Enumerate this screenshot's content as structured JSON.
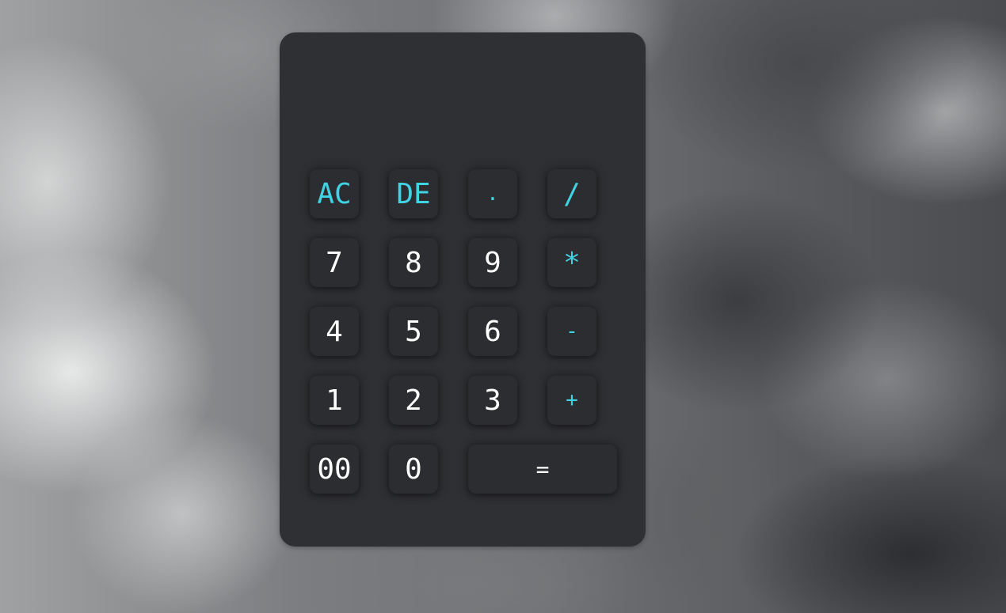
{
  "calculator": {
    "display_value": "",
    "accent_color": "#3fd3e4",
    "keys": {
      "ac": "AC",
      "de": "DE",
      "dot": ".",
      "divide": "/",
      "seven": "7",
      "eight": "8",
      "nine": "9",
      "multiply": "*",
      "four": "4",
      "five": "5",
      "six": "6",
      "minus": "-",
      "one": "1",
      "two": "2",
      "three": "3",
      "plus": "+",
      "double_zero": "00",
      "zero": "0",
      "equals": "="
    }
  }
}
